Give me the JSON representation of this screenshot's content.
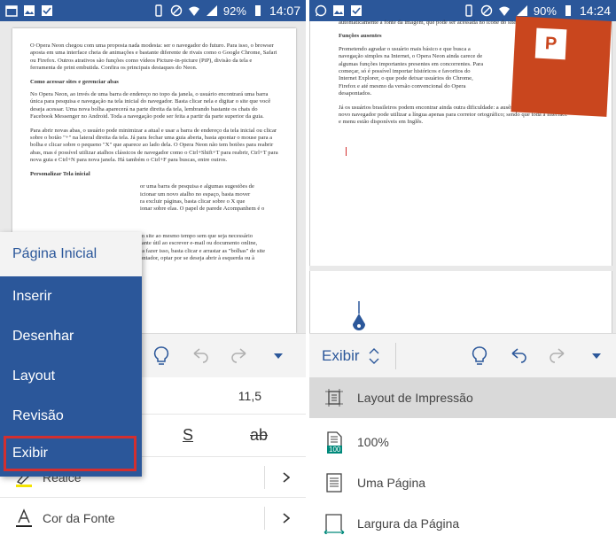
{
  "left": {
    "status": {
      "battery": "92%",
      "time": "14:07"
    },
    "doc": {
      "p1": "O Opera Neon chegou com uma proposta nada modesta: ser o navegador do futuro. Para isso, o browser aposta em uma interface cheia de animações e bastante diferente de rivais como o Google Chrome, Safari ou Firefox. Outros atrativos são funções como vídeos Picture-in-picture (PiP), divisão da tela e ferramenta de print embutida. Confira os principais destaques do Neon.",
      "h1": "Como acessar sites e gerenciar abas",
      "p2": "No Opera Neon, ao invés de uma barra de endereço no topo da janela, o usuário encontrará uma barra única para pesquisa e navegação na tela inicial do navegador. Basta clicar nela e digitar o site que você deseja acessar. Uma nova bolha aparecerá na parte direita da tela, lembrando bastante os chats do Facebook Messenger no Android. Toda a navegação pode ser feita a partir da parte superior da guia.",
      "p3": "Para abrir novas abas, o usuário pode minimizar a atual e usar a barra de endereço da tela inicial ou clicar sobre o botão \"+\" na lateral direita da tela. Já para fechar uma guia aberta, basta apontar o mouse para a bolha e clicar sobre o pequeno \"X\" que aparece ao lado dela. O Opera Neon não tem botões para reabrir abas, mas é possível utilizar atalhos clássicos de navegador como o Ctrl+Shift+T para reabrir, Ctrl+T para nova guia e Ctrl+N para nova janela. Há também o Ctrl+F para buscas, entre outros.",
      "h2": "Personalizar Tela inicial",
      "p4a": "or uma barra de pesquisa e algumas sugestões de",
      "p4b": "icionar um novo atalho no espaço, basta mover",
      "p4c": "ra excluir páginas, basta clicar sobre o X que",
      "p4d": "ionar sobre elas. O papel de parede Acompanhem é o",
      "p5a": "m site ao mesmo tempo sem que seja necessário",
      "p5b": "tante útil ao escrever e-mail ou documento online,",
      "p5c": "ra fazer isso, basta clicar e arrastar as \"bolhas\" de site",
      "p5d": "ontador, optar por se deseja abrir à esquerda ou à"
    },
    "menu": {
      "items": [
        "Página Inicial",
        "Inserir",
        "Desenhar",
        "Layout",
        "Revisão",
        "Exibir"
      ]
    },
    "font_size": "11,5",
    "realce_label": "Realce",
    "font_color_label": "Cor da Fonte",
    "format_underline": "S",
    "format_strike": "ab"
  },
  "right": {
    "status": {
      "battery": "90%",
      "time": "14:24"
    },
    "doc": {
      "top": "automaticamente a fonte da imagem, que pode ser acessada no ícone do site.",
      "h1": "Funções ausentes",
      "p1": "Prometendo agradar o usuário mais básico e que busca a navegação simples na Internet, o Opera Neon ainda carece de algumas funções importantes presentes em concorrentes. Para começar, só é possível importar históricos e favoritos do Internet Explorer, o que pode deixar usuários do Chrome, Firefox e até mesmo da versão convencional do Opera desapontados.",
      "p2": "Já os usuários brasileiros podem encontrar ainda outra dificuldade: a ausência do Português. O novo navegador pode utilizar a língua apenas para corretor ortográfico; sendo que toda a interface e menu estão disponíveis em Inglês."
    },
    "tab_label": "Exibir",
    "options": [
      "Layout de Impressão",
      "100%",
      "Uma Página",
      "Largura da Página"
    ],
    "zoom_badge": "100"
  }
}
